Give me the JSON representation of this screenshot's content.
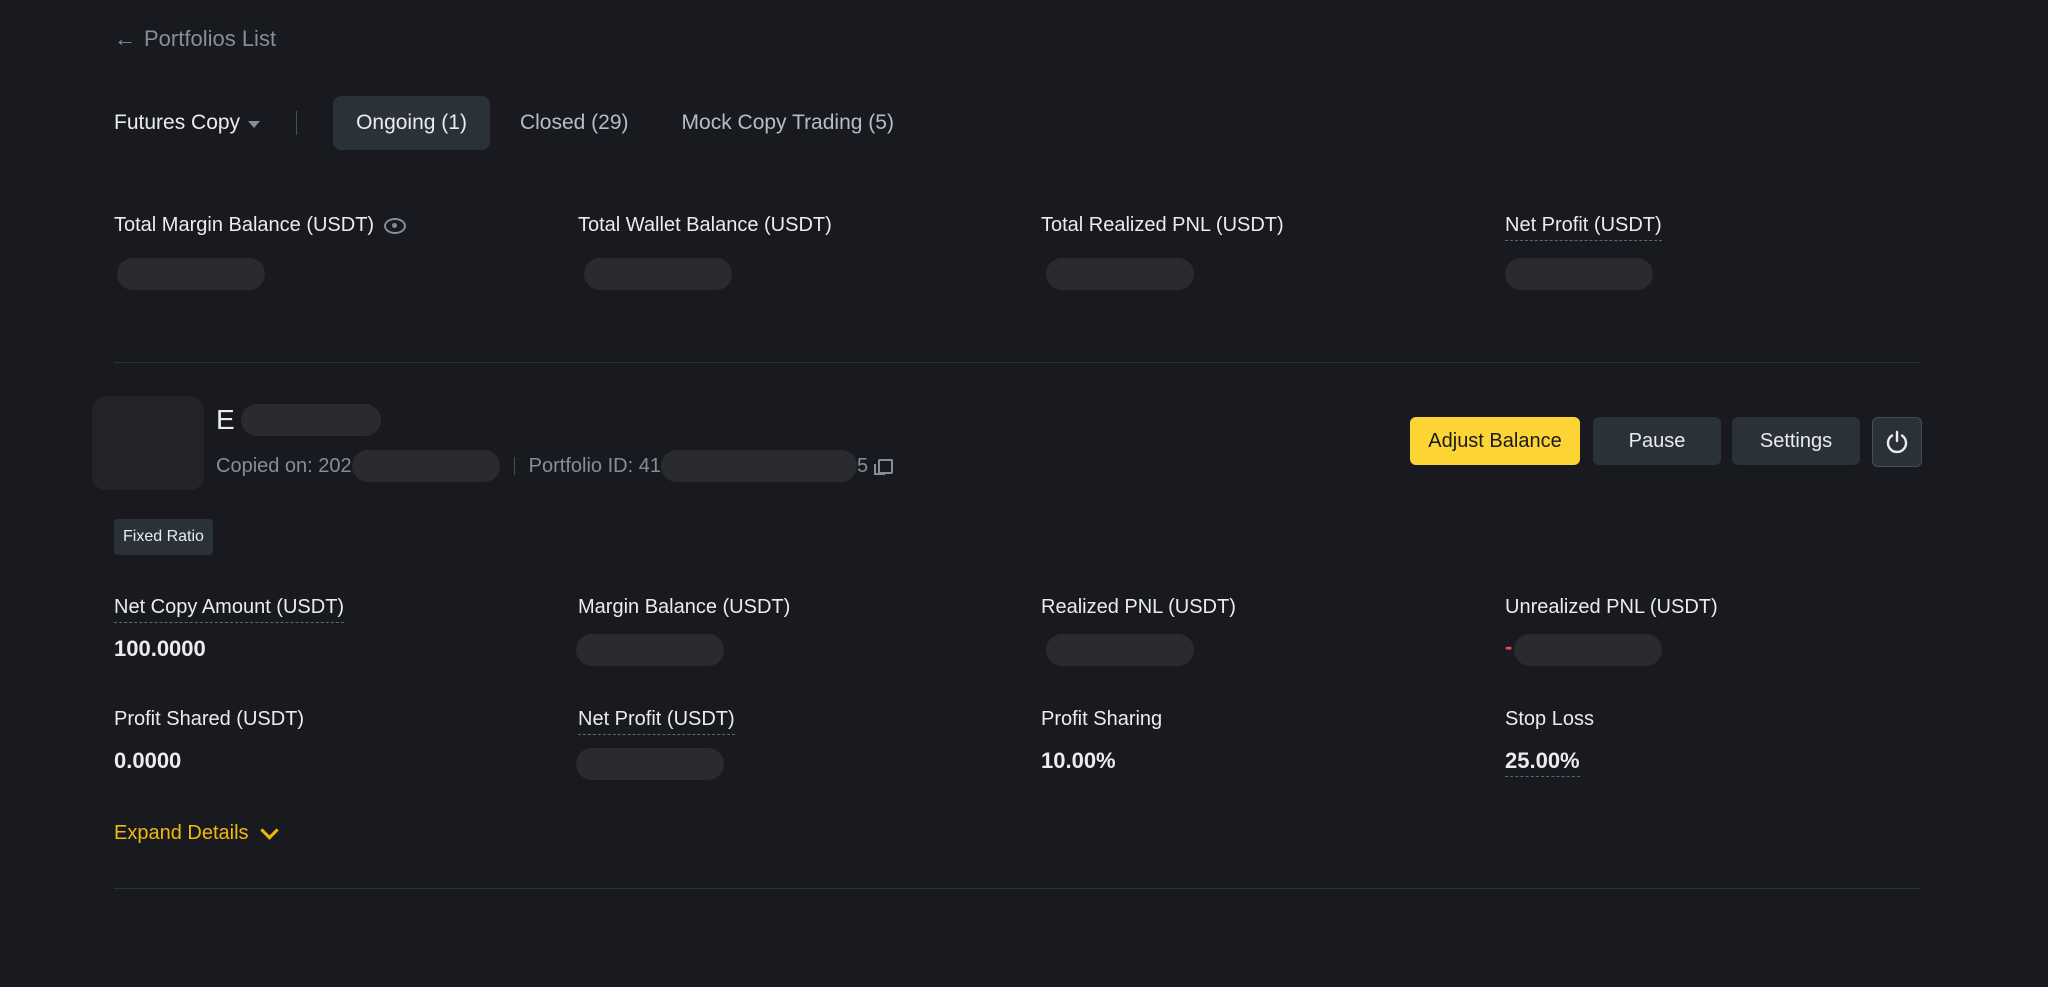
{
  "nav": {
    "back_label": "Portfolios List"
  },
  "tabs": {
    "dropdown_label": "Futures Copy",
    "items": [
      {
        "label": "Ongoing (1)",
        "active": true
      },
      {
        "label": "Closed (29)",
        "active": false
      },
      {
        "label": "Mock Copy Trading (5)",
        "active": false
      }
    ]
  },
  "summary": {
    "total_margin_balance_label": "Total Margin Balance (USDT)",
    "total_wallet_balance_label": "Total Wallet Balance (USDT)",
    "total_realized_pnl_label": "Total Realized PNL (USDT)",
    "net_profit_label": "Net Profit (USDT)"
  },
  "portfolio": {
    "name_initial": "E",
    "copied_on_prefix": "Copied on: 202",
    "portfolio_id_prefix": "Portfolio ID: 41",
    "portfolio_id_suffix": "5",
    "actions": {
      "adjust_balance": "Adjust Balance",
      "pause": "Pause",
      "settings": "Settings"
    },
    "mode_badge": "Fixed Ratio",
    "metrics": {
      "net_copy_amount_label": "Net Copy Amount (USDT)",
      "net_copy_amount_value": "100.0000",
      "margin_balance_label": "Margin Balance (USDT)",
      "realized_pnl_label": "Realized PNL (USDT)",
      "unrealized_pnl_label": "Unrealized PNL (USDT)",
      "unrealized_pnl_sign": "-",
      "profit_shared_label": "Profit Shared (USDT)",
      "profit_shared_value": "0.0000",
      "net_profit_label": "Net Profit (USDT)",
      "profit_sharing_label": "Profit Sharing",
      "profit_sharing_value": "10.00%",
      "stop_loss_label": "Stop Loss",
      "stop_loss_value": "25.00%"
    },
    "expand_label": "Expand Details"
  },
  "colors": {
    "background": "#181a20",
    "accent_yellow": "#fcd535",
    "link_yellow": "#f0b90b",
    "positive_green": "#2ebd85",
    "negative_red": "#f6465d"
  }
}
